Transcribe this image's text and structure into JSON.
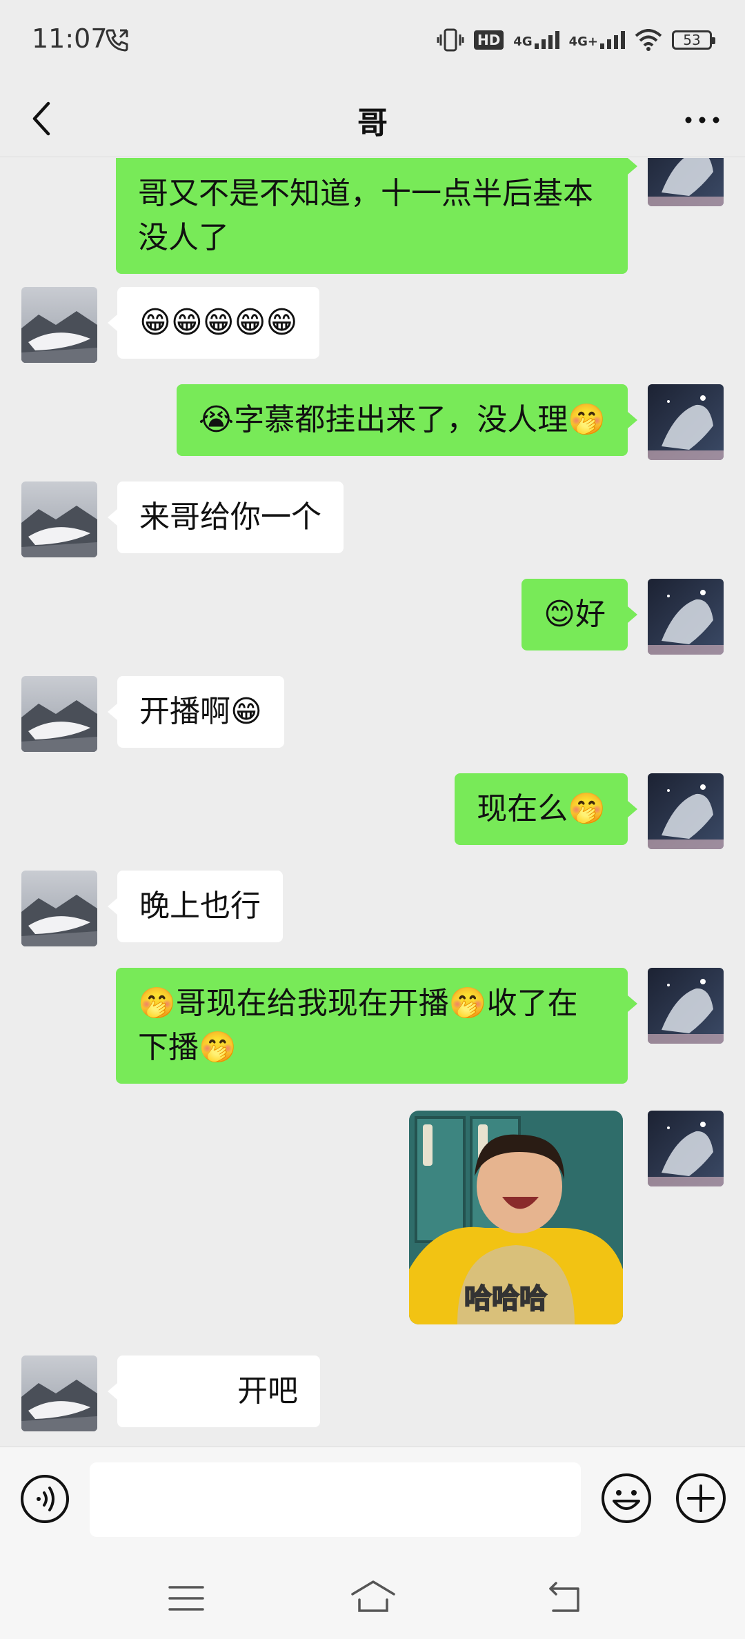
{
  "status_bar": {
    "time": "11:07",
    "network_hd": "HD",
    "network_1": "4G",
    "network_2": "4G+",
    "battery_level": "53"
  },
  "header": {
    "title": "哥"
  },
  "messages": [
    {
      "id": 0,
      "side": "out",
      "text": "哥又不是不知道，十一点半后基本没人了"
    },
    {
      "id": 1,
      "side": "in",
      "text": "😁😁😁😁😁"
    },
    {
      "id": 2,
      "side": "out",
      "text": "😭字慕都挂出来了，没人理🤭"
    },
    {
      "id": 3,
      "side": "in",
      "text": "来哥给你一个"
    },
    {
      "id": 4,
      "side": "out",
      "text": "😊好"
    },
    {
      "id": 5,
      "side": "in",
      "text": "开播啊😁"
    },
    {
      "id": 6,
      "side": "out",
      "text": "现在么🤭"
    },
    {
      "id": 7,
      "side": "in",
      "text": "晚上也行"
    },
    {
      "id": 8,
      "side": "out",
      "text": "🤭哥现在给我现在开播🤭收了在下播🤭"
    },
    {
      "id": 9,
      "side": "out",
      "type": "sticker",
      "caption": "哈哈哈"
    },
    {
      "id": 10,
      "side": "in",
      "text": "开吧"
    }
  ],
  "input": {
    "placeholder": ""
  },
  "colors": {
    "background": "#ededed",
    "out_bubble": "#78ea58",
    "in_bubble": "#ffffff"
  }
}
